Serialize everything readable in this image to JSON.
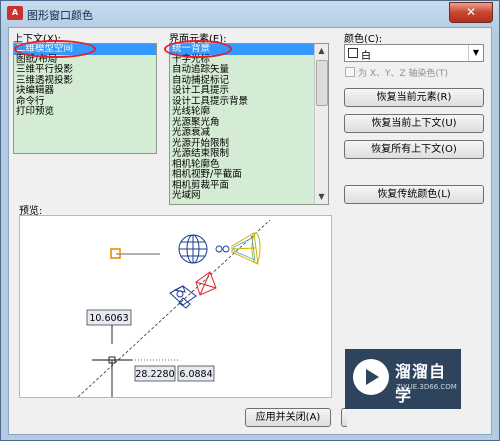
{
  "window": {
    "title": "图形窗口颜色",
    "close": "✕"
  },
  "context": {
    "label": "上下文(X):",
    "items": [
      "二维模型空间",
      "图纸/布局",
      "三维平行投影",
      "三维透视投影",
      "块编辑器",
      "命令行",
      "打印预览"
    ],
    "selected": 0
  },
  "elements": {
    "label": "界面元素(E):",
    "items": [
      "统一背景",
      "十字光标",
      "自动追踪矢量",
      "自动捕捉标记",
      "设计工具提示",
      "设计工具提示背景",
      "光线轮廓",
      "光源聚光角",
      "光源衰减",
      "光源开始限制",
      "光源结束限制",
      "相机轮廓色",
      "相机视野/平截面",
      "相机剪裁平面",
      "光域网"
    ],
    "selected": 0
  },
  "color": {
    "label": "颜色(C):",
    "value": "白",
    "tint_label": "为 X、Y、Z 轴染色(T)"
  },
  "buttons": {
    "restore_element": "恢复当前元素(R)",
    "restore_context": "恢复当前上下文(U)",
    "restore_all": "恢复所有上下文(O)",
    "restore_classic": "恢复传统颜色(L)",
    "apply_close": "应用并关闭(A)"
  },
  "preview": {
    "label": "预览:",
    "dim1": "10.6063",
    "dim2": "28.2280",
    "dim3": "6.0884"
  },
  "watermark": {
    "name": "溜溜自学",
    "url": "ZIXUE.3D66.COM"
  }
}
